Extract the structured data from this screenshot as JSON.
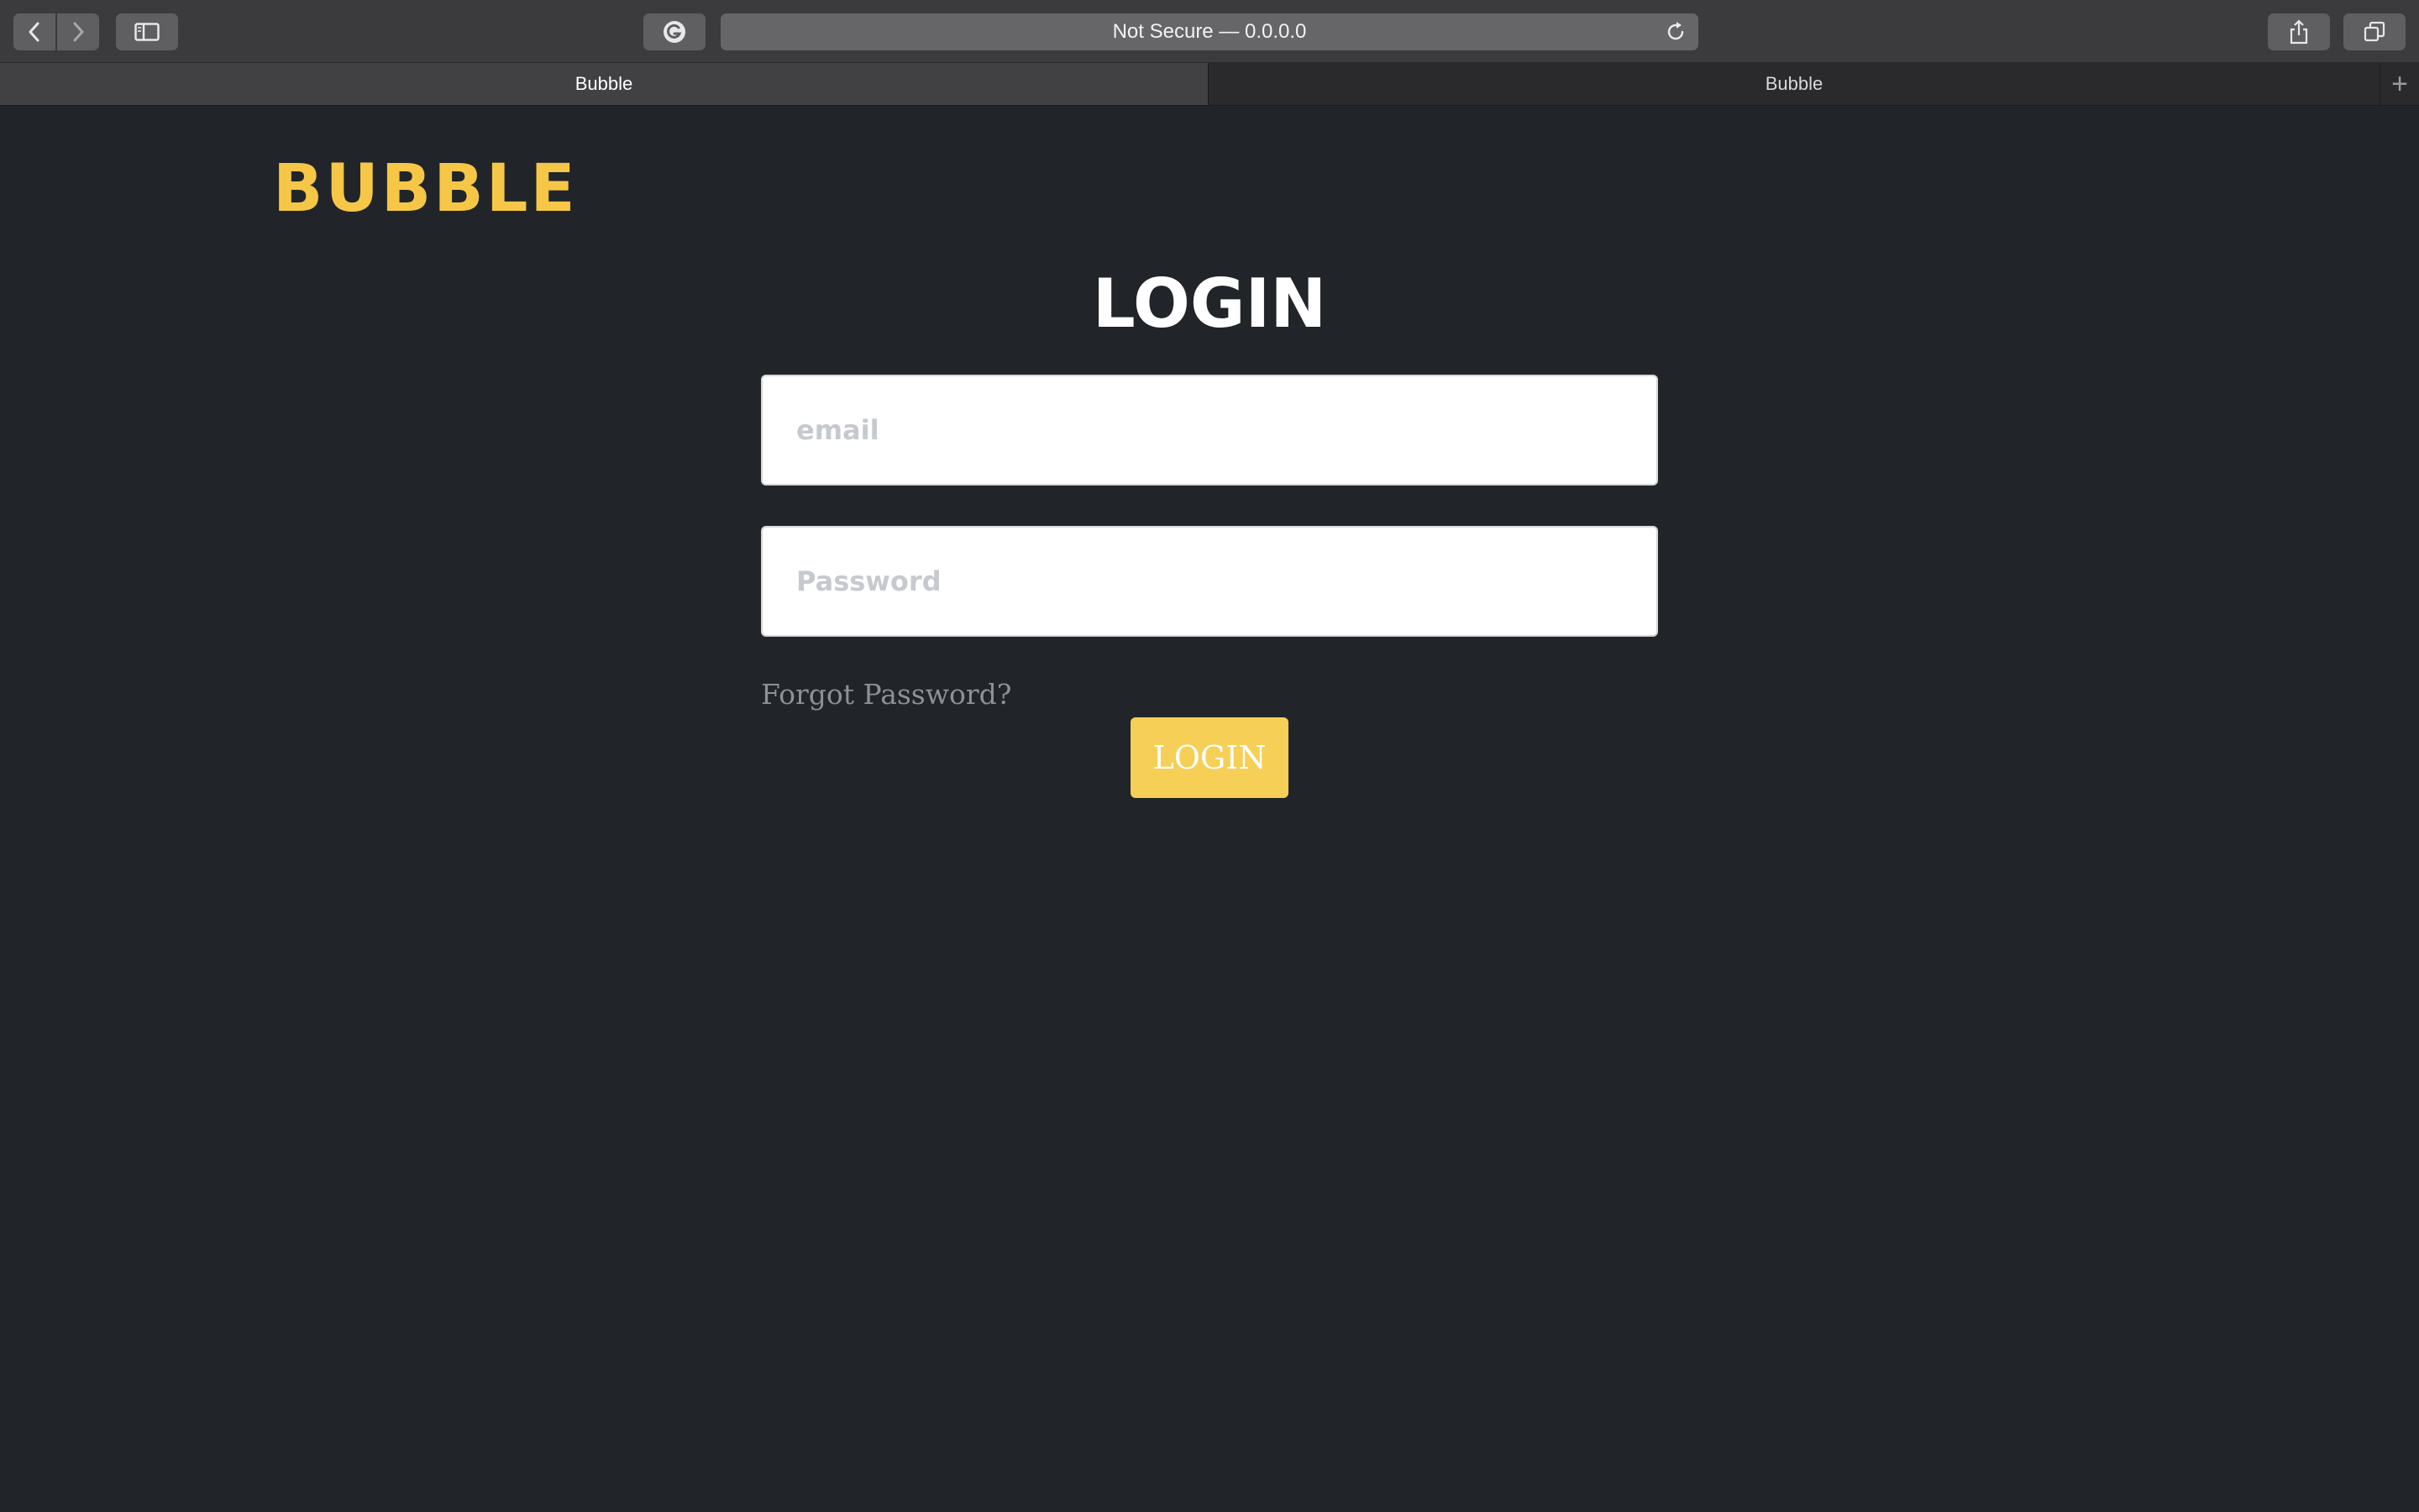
{
  "browser": {
    "address_text": "Not Secure — 0.0.0.0",
    "tabs": [
      {
        "label": "Bubble",
        "active": true
      },
      {
        "label": "Bubble",
        "active": false
      }
    ],
    "new_tab_symbol": "+"
  },
  "icons": {
    "back": "chevron-left-icon",
    "forward": "chevron-right-icon",
    "sidebar": "sidebar-icon",
    "extension": "grammarly-icon",
    "reload": "reload-icon",
    "share": "share-icon",
    "tabs_overview": "tabs-overview-icon"
  },
  "colors": {
    "background": "#212429",
    "brand_yellow": "#f6c746",
    "button_yellow": "#f6cf56",
    "text_white": "#ffffff",
    "link_gray": "#8e9095"
  },
  "page": {
    "logo": "BUBBLE",
    "title": "LOGIN",
    "email": {
      "value": "",
      "placeholder": "email"
    },
    "password": {
      "value": "",
      "placeholder": "Password"
    },
    "forgot_label": "Forgot Password?",
    "login_button_label": "LOGIN"
  }
}
